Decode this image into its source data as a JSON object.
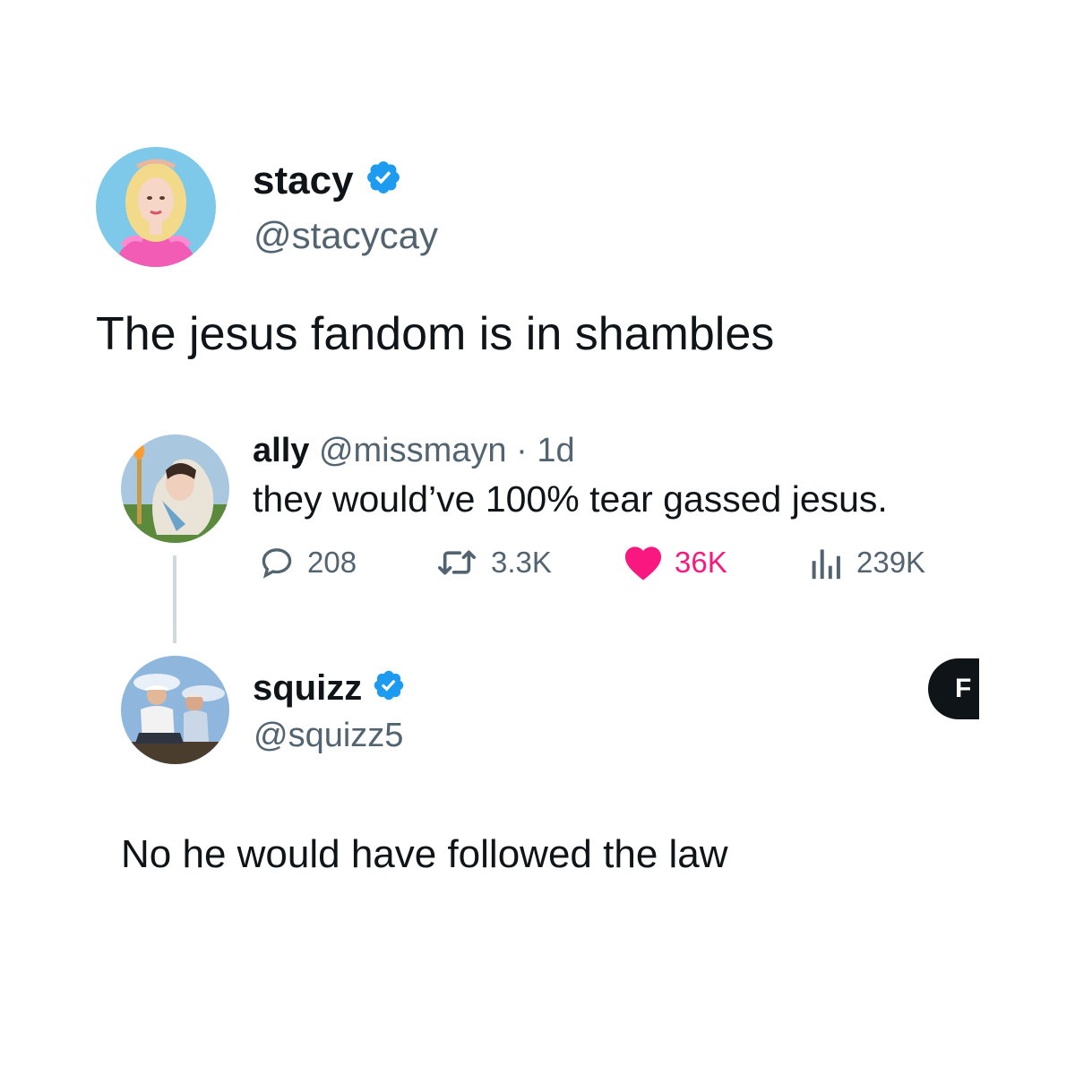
{
  "main_tweet": {
    "display_name": "stacy",
    "verified": true,
    "handle": "@stacycay",
    "text": "The jesus fandom is in shambles"
  },
  "quoted_tweet": {
    "display_name": "ally",
    "handle": "@missmayn",
    "separator": "·",
    "age": "1d",
    "text": "they would’ve 100% tear gassed jesus.",
    "stats": {
      "replies": "208",
      "reposts": "3.3K",
      "likes": "36K",
      "views": "239K"
    }
  },
  "reply_tweet": {
    "display_name": "squizz",
    "verified": true,
    "handle": "@squizz5",
    "text": "No he would have followed the law",
    "follow_button_label": "F"
  },
  "colors": {
    "verified_badge": "#1d9bf0",
    "like_active": "#f91880",
    "secondary_text": "#536471",
    "thread_line": "#cfd9de"
  },
  "icons": {
    "reply": "speech-bubble-icon",
    "repost": "repost-arrows-icon",
    "like": "heart-filled-icon",
    "views": "bar-chart-icon",
    "verified": "verified-badge-icon"
  }
}
